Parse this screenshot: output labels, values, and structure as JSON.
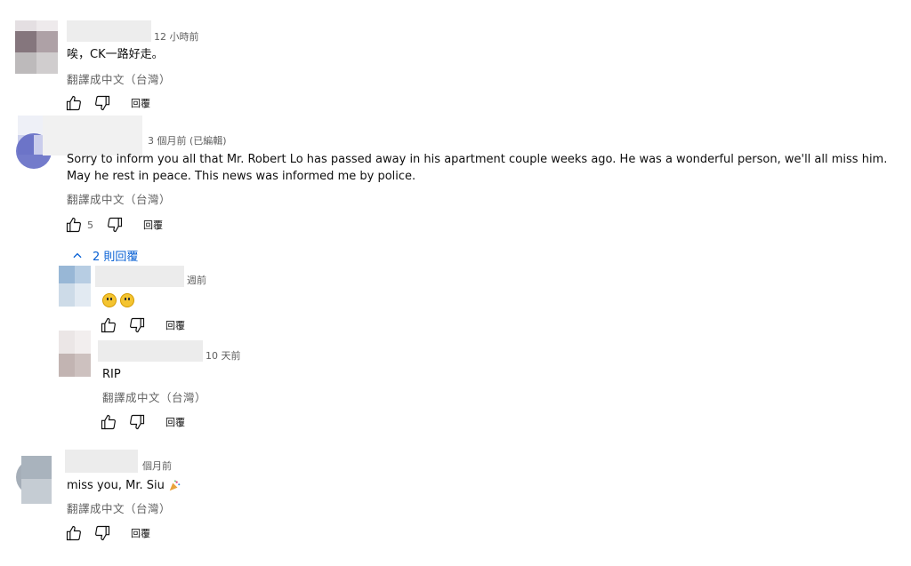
{
  "comments": [
    {
      "time": "12 小時前",
      "text": "唉，CK一路好走。",
      "translate": "翻譯成中文（台灣）",
      "reply": "回覆",
      "likes": ""
    },
    {
      "time": "3 個月前 (已編輯)",
      "text": "Sorry to inform you all that Mr. Robert Lo has passed away  in his apartment couple weeks ago. He was a wonderful person, we'll all miss him. May he rest in peace. This news was informed me by police.",
      "translate": "翻譯成中文（台灣）",
      "reply": "回覆",
      "likes": "5",
      "replies_toggle": "2 則回覆",
      "replies": [
        {
          "time": "週前",
          "text": "",
          "reply": "回覆"
        },
        {
          "time": "10 天前",
          "text": "RIP",
          "translate": "翻譯成中文（台灣）",
          "reply": "回覆"
        }
      ]
    },
    {
      "time": "個月前",
      "text": "miss you, Mr. Siu",
      "translate": "翻譯成中文（台灣）",
      "reply": "回覆",
      "likes": ""
    }
  ],
  "icons": {
    "like": "thumbs-up-icon",
    "dislike": "thumbs-down-icon",
    "chevron": "chevron-up-icon"
  },
  "colors": {
    "link": "#065fd4",
    "meta": "#606060"
  }
}
